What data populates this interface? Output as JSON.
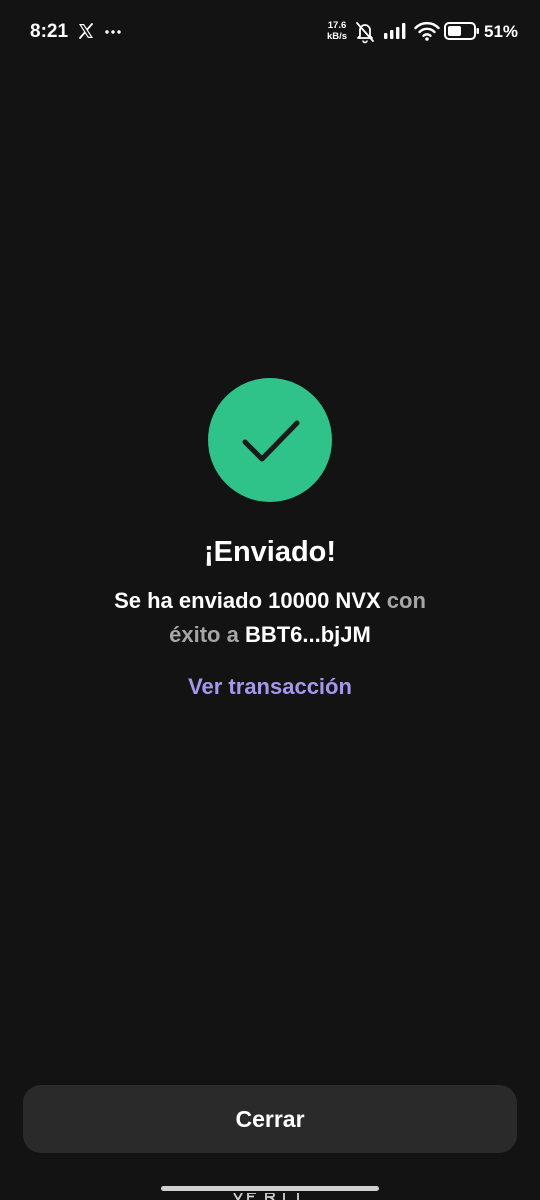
{
  "status_bar": {
    "time": "8:21",
    "net_speed_value": "17.6",
    "net_speed_unit": "kB/s",
    "battery": "51%",
    "icons": [
      "x-logo-icon",
      "more-dots-icon",
      "mute-icon",
      "signal-icon",
      "wifi-icon",
      "battery-icon"
    ]
  },
  "success": {
    "icon": "checkmark-icon",
    "title": "¡Enviado!",
    "message_part1": "Se ha enviado 10000 NVX",
    "message_part2": " con",
    "message_part3": "éxito a",
    "message_part4": " BBT6...bjJM",
    "link_label": "Ver transacción"
  },
  "footer": {
    "close_label": "Cerrar"
  },
  "colors": {
    "background": "#131313",
    "success_green": "#2fc289",
    "link_purple": "#a796ee",
    "button_bg": "#2a2a2a",
    "muted_text": "#a6a6a6"
  }
}
